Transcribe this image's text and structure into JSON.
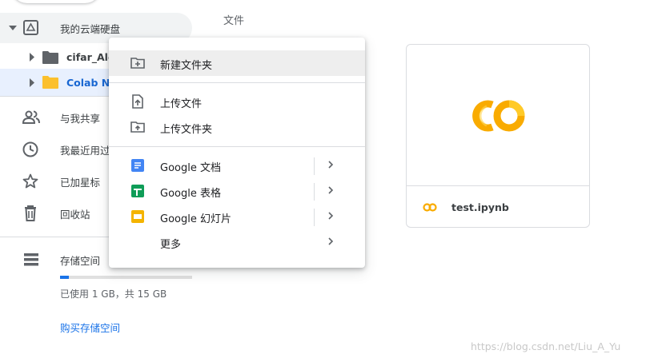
{
  "sidebar": {
    "my_drive": "我的云端硬盘",
    "folders": [
      {
        "label": "cifar_Ale"
      },
      {
        "label": "Colab No"
      }
    ],
    "items": [
      {
        "label": "与我共享",
        "icon": "people-icon"
      },
      {
        "label": "我最近用过",
        "icon": "clock-icon"
      },
      {
        "label": "已加星标",
        "icon": "star-icon"
      },
      {
        "label": "回收站",
        "icon": "trash-icon"
      }
    ],
    "storage": {
      "label": "存储空间",
      "usage_text": "已使用 1 GB，共 15 GB",
      "used_fraction": 0.067,
      "buy_link": "购买存储空间"
    }
  },
  "main": {
    "files_heading": "文件",
    "file_card": {
      "name": "test.ipynb",
      "logo_text": "CO"
    }
  },
  "context_menu": {
    "new_folder": "新建文件夹",
    "upload_file": "上传文件",
    "upload_folder": "上传文件夹",
    "google_docs": "Google 文档",
    "google_sheets": "Google 表格",
    "google_slides": "Google 幻灯片",
    "more": "更多"
  },
  "watermark": "https://blog.csdn.net/Liu_A_Yu",
  "colors": {
    "accent": "#1a73e8",
    "docs": "#4285f4",
    "sheets": "#0f9d58",
    "slides": "#f4b400",
    "colab": "#f9ab00",
    "folder_grey": "#5f6368",
    "folder_yellow": "#fbc02d"
  }
}
